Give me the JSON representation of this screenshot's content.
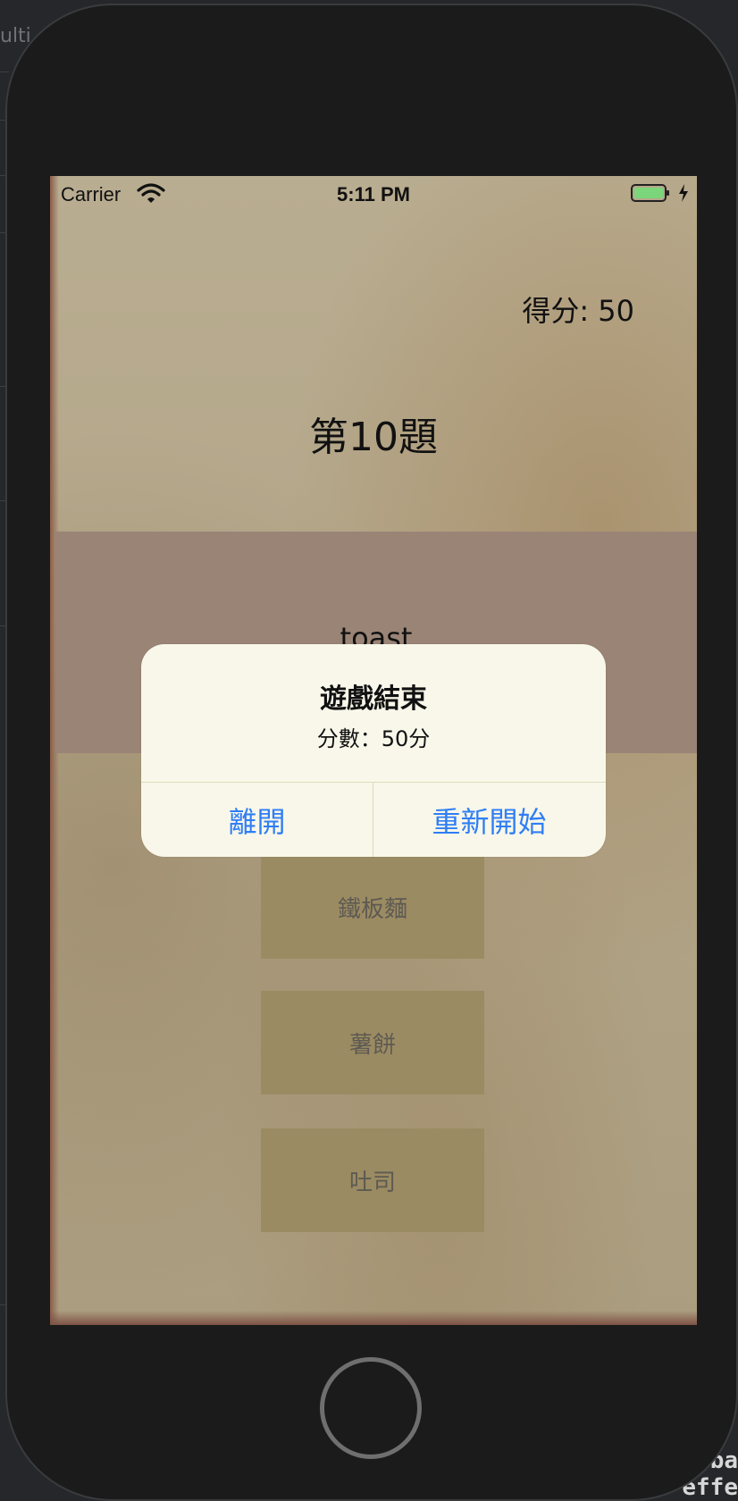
{
  "ide": {
    "tab_fragment": "ulti",
    "bottom_code_lines": [
      "ba",
      "effe"
    ]
  },
  "status_bar": {
    "carrier": "Carrier",
    "time": "5:11 PM",
    "battery_color": "#7bd67b"
  },
  "game": {
    "score_label": "得分: 50",
    "question_title": "第10題",
    "word": "toast",
    "choices": [
      "鐵板麵",
      "薯餅",
      "吐司"
    ]
  },
  "alert": {
    "title": "遊戲結束",
    "message": "分數：50分",
    "leave_button": "離開",
    "restart_button": "重新開始",
    "button_color": "#2f7ef5"
  },
  "icons": {
    "wifi": "wifi-icon",
    "battery": "battery-icon",
    "charging": "charging-bolt-icon",
    "home": "home-button"
  }
}
